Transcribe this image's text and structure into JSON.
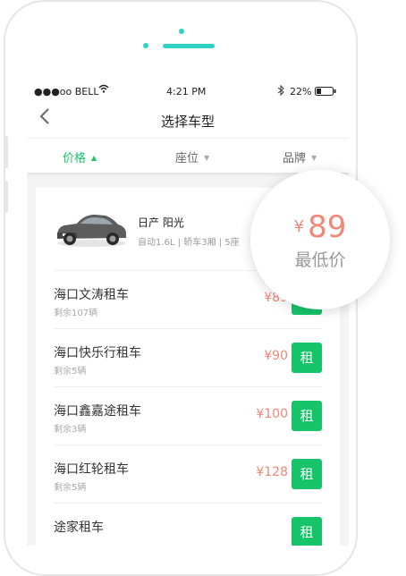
{
  "status_bar": {
    "carrier": "●●●oo BELL",
    "time": "4:21 PM",
    "battery": "22%"
  },
  "nav": {
    "back_icon": "chevron-left-icon",
    "title": "选择车型"
  },
  "filters": [
    {
      "label": "价格",
      "active": true
    },
    {
      "label": "座位",
      "active": false
    },
    {
      "label": "品牌",
      "active": false
    }
  ],
  "car": {
    "name": "日产 阳光",
    "spec": "自动1.6L | 轿车3厢 | 5座"
  },
  "price_badge": {
    "currency": "¥",
    "price": "89",
    "label": "最低价"
  },
  "shops": [
    {
      "name": "海口文涛租车",
      "stock": "剩余107辆",
      "price": "¥89",
      "button": "租"
    },
    {
      "name": "海口快乐行租车",
      "stock": "剩余5辆",
      "price": "¥90",
      "button": "租"
    },
    {
      "name": "海口鑫嘉途租车",
      "stock": "剩余3辆",
      "price": "¥100",
      "button": "租"
    },
    {
      "name": "海口红轮租车",
      "stock": "剩余5辆",
      "price": "¥128",
      "button": "租"
    },
    {
      "name": "途家租车",
      "stock": "",
      "price": "",
      "button": "租"
    }
  ],
  "colors": {
    "accent": "#17c46a",
    "price": "#f08878",
    "phone_sensor": "#2fd3c6"
  }
}
